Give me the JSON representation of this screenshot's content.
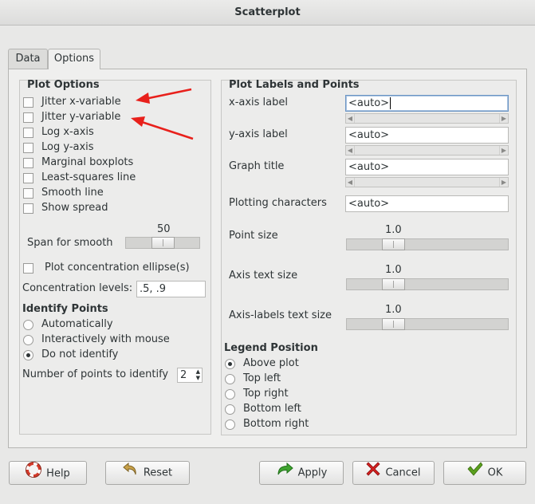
{
  "window": {
    "title": "Scatterplot"
  },
  "tabs": [
    {
      "label": "Data"
    },
    {
      "label": "Options"
    }
  ],
  "plot_options": {
    "header": "Plot Options",
    "checks": [
      {
        "label": "Jitter x-variable",
        "checked": false
      },
      {
        "label": "Jitter y-variable",
        "checked": false
      },
      {
        "label": "Log x-axis",
        "checked": false
      },
      {
        "label": "Log y-axis",
        "checked": false
      },
      {
        "label": "Marginal boxplots",
        "checked": false
      },
      {
        "label": "Least-squares line",
        "checked": false
      },
      {
        "label": "Smooth line",
        "checked": false
      },
      {
        "label": "Show spread",
        "checked": false
      }
    ],
    "span_label": "Span for smooth",
    "span_value": "50",
    "ellipse_label": "Plot concentration ellipse(s)",
    "conc_label": "Concentration levels:",
    "conc_value": ".5, .9"
  },
  "identify": {
    "header": "Identify Points",
    "options": [
      {
        "label": "Automatically",
        "selected": false
      },
      {
        "label": "Interactively with mouse",
        "selected": false
      },
      {
        "label": "Do not identify",
        "selected": true
      }
    ],
    "count_label": "Number of points to identify",
    "count_value": "2"
  },
  "labels": {
    "header": "Plot Labels and Points",
    "xaxis_label": "x-axis label",
    "xaxis_value": "<auto>",
    "yaxis_label": "y-axis label",
    "yaxis_value": "<auto>",
    "title_label": "Graph title",
    "title_value": "<auto>",
    "pch_label": "Plotting characters",
    "pch_value": "<auto>",
    "point_size_label": "Point size",
    "point_size_value": "1.0",
    "axis_text_label": "Axis text size",
    "axis_text_value": "1.0",
    "axis_labels_label": "Axis-labels text size",
    "axis_labels_value": "1.0"
  },
  "legend": {
    "header": "Legend Position",
    "options": [
      {
        "label": "Above plot",
        "selected": true
      },
      {
        "label": "Top left",
        "selected": false
      },
      {
        "label": "Top right",
        "selected": false
      },
      {
        "label": "Bottom left",
        "selected": false
      },
      {
        "label": "Bottom right",
        "selected": false
      }
    ]
  },
  "buttons": {
    "help": "Help",
    "reset": "Reset",
    "apply": "Apply",
    "cancel": "Cancel",
    "ok": "OK"
  },
  "colors": {
    "annotation_arrow": "#e8201b",
    "apply_icon": "#3fa32f",
    "cancel_icon": "#d42020",
    "ok_icon": "#5aa01e"
  }
}
